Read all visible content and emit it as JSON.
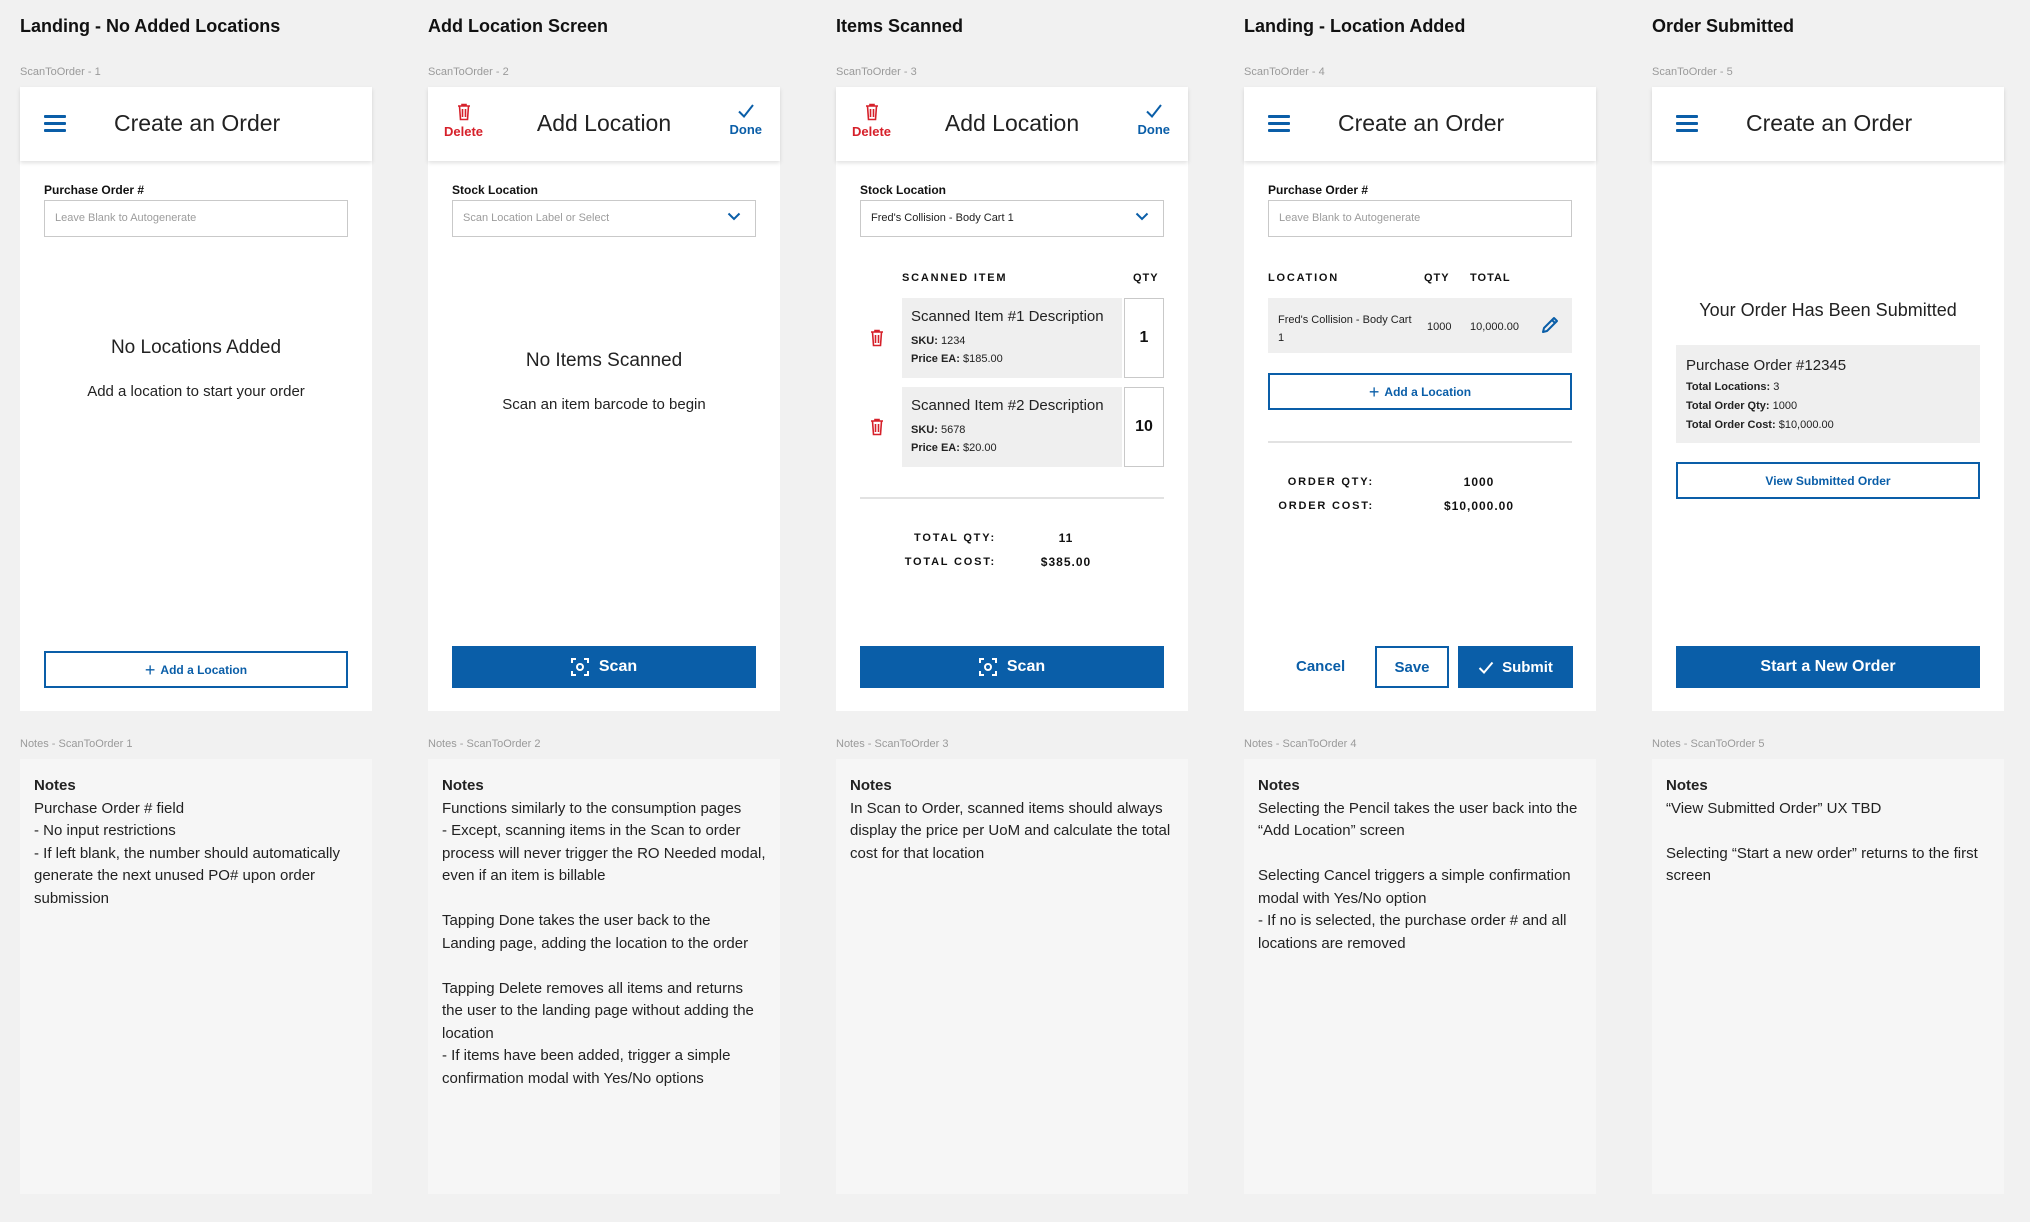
{
  "screens": [
    {
      "title": "Landing - No Added Locations",
      "frame_label": "ScanToOrder - 1",
      "app_title": "Create an Order",
      "field_label": "Purchase Order #",
      "field_placeholder": "Leave Blank to Autogenerate",
      "empty_title": "No Locations Added",
      "empty_sub": "Add a location to start your order",
      "add_location_label": "Add a Location",
      "notes_label": "Notes - ScanToOrder 1",
      "notes_heading": "Notes",
      "notes_body": "Purchase Order # field\n- No input restrictions\n- If left blank, the number should automatically generate the next unused PO# upon order submission"
    },
    {
      "title": "Add Location Screen",
      "frame_label": "ScanToOrder - 2",
      "app_title": "Add Location",
      "delete_label": "Delete",
      "done_label": "Done",
      "field_label": "Stock Location",
      "field_placeholder": "Scan Location Label or Select",
      "empty_title": "No Items Scanned",
      "empty_sub": "Scan an item barcode to begin",
      "scan_label": "Scan",
      "notes_label": "Notes - ScanToOrder 2",
      "notes_heading": "Notes",
      "notes_body": "Functions similarly to the consumption pages\n- Except, scanning items in the Scan to order process will never trigger the RO Needed modal, even if an item is billable\n\nTapping Done takes the user back to the Landing page, adding the location to the order\n\nTapping Delete removes all items and returns the user to the landing page without adding the location\n- If items have been added, trigger a simple confirmation modal with Yes/No options"
    },
    {
      "title": "Items Scanned",
      "frame_label": "ScanToOrder - 3",
      "app_title": "Add Location",
      "delete_label": "Delete",
      "done_label": "Done",
      "field_label": "Stock Location",
      "field_value": "Fred's Collision - Body Cart 1",
      "col_item": "SCANNED ITEM",
      "col_qty": "QTY",
      "items": [
        {
          "name": "Scanned Item #1 Description",
          "sku_label": "SKU:",
          "sku": "1234",
          "price_label": "Price EA:",
          "price": "$185.00",
          "qty": "1"
        },
        {
          "name": "Scanned Item #2 Description",
          "sku_label": "SKU:",
          "sku": "5678",
          "price_label": "Price EA:",
          "price": "$20.00",
          "qty": "10"
        }
      ],
      "total_qty_label": "TOTAL QTY:",
      "total_qty": "11",
      "total_cost_label": "TOTAL COST:",
      "total_cost": "$385.00",
      "scan_label": "Scan",
      "notes_label": "Notes - ScanToOrder 3",
      "notes_heading": "Notes",
      "notes_body": "In Scan to Order, scanned items should always display the price per UoM and calculate the total cost for that location"
    },
    {
      "title": "Landing - Location Added",
      "frame_label": "ScanToOrder - 4",
      "app_title": "Create an Order",
      "field_label": "Purchase Order #",
      "field_placeholder": "Leave Blank to Autogenerate",
      "col_location": "LOCATION",
      "col_qty": "QTY",
      "col_total": "TOTAL",
      "location": {
        "name": "Fred's Collision - Body Cart 1",
        "qty": "1000",
        "total": "10,000.00"
      },
      "add_location_label": "Add a Location",
      "order_qty_label": "ORDER QTY:",
      "order_qty": "1000",
      "order_cost_label": "ORDER COST:",
      "order_cost": "$10,000.00",
      "cancel_label": "Cancel",
      "save_label": "Save",
      "submit_label": "Submit",
      "notes_label": "Notes - ScanToOrder 4",
      "notes_heading": "Notes",
      "notes_body": "Selecting the Pencil takes the user back into the “Add Location” screen\n\nSelecting Cancel triggers a simple confirmation modal with Yes/No option\n- If no is selected, the purchase order # and all locations are removed"
    },
    {
      "title": "Order Submitted",
      "frame_label": "ScanToOrder - 5",
      "app_title": "Create an Order",
      "submitted_title": "Your Order Has Been Submitted",
      "po_title": "Purchase Order #12345",
      "total_locations_label": "Total Locations:",
      "total_locations": "3",
      "total_qty_label": "Total Order Qty:",
      "total_qty": "1000",
      "total_cost_label": "Total Order Cost:",
      "total_cost": "$10,000.00",
      "view_label": "View Submitted Order",
      "start_label": "Start a New Order",
      "notes_label": "Notes - ScanToOrder 5",
      "notes_heading": "Notes",
      "notes_body": "“View Submitted Order” UX TBD\n\nSelecting “Start a new order” returns to the first screen"
    }
  ],
  "colors": {
    "primary": "#0a5ea8",
    "danger": "#d6202a",
    "row_bg": "#efefef",
    "canvas": "#f1f1f1"
  }
}
